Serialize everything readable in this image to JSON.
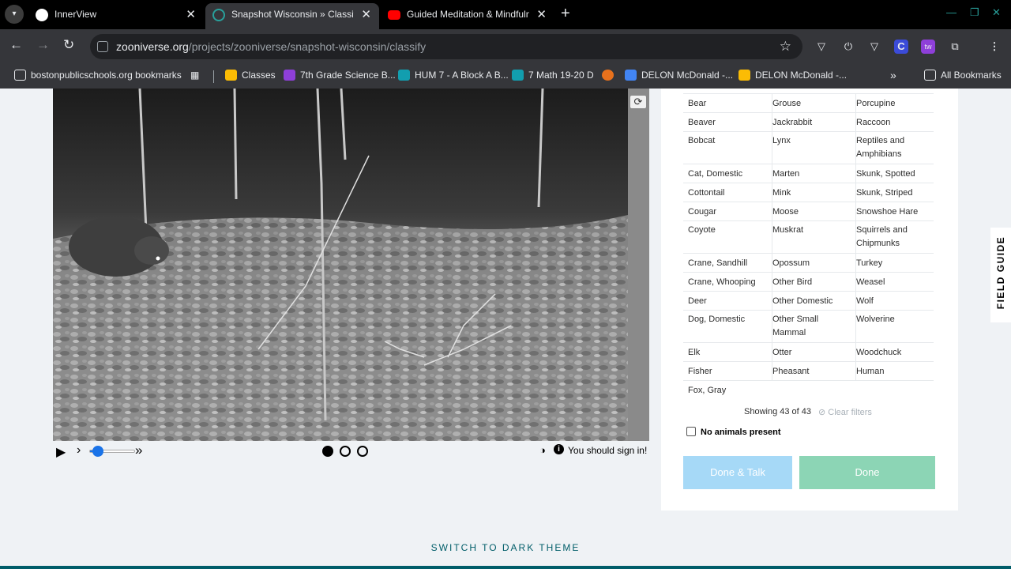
{
  "browser": {
    "tabs": [
      {
        "title": "InnerView",
        "icon": "innerview-favicon",
        "active": false
      },
      {
        "title": "Snapshot Wisconsin » Classify",
        "icon": "zooniverse-favicon",
        "active": true
      },
      {
        "title": "Guided Meditation & Mindfulne",
        "icon": "youtube-favicon",
        "active": false
      }
    ],
    "url_domain": "zooniverse.org",
    "url_path": "/projects/zooniverse/snapshot-wisconsin/classify",
    "bookmarks": [
      {
        "label": "bostonpublicschools.org bookmarks",
        "icon": "folder-icon"
      },
      {
        "label": "Classes",
        "icon": "classroom-icon"
      },
      {
        "label": "7th Grade Science B...",
        "icon": "classroom-icon"
      },
      {
        "label": "HUM 7 - A Block A B...",
        "icon": "classroom-icon"
      },
      {
        "label": "7 Math 19-20 D",
        "icon": "classroom-icon"
      },
      {
        "label": "DELON McDonald -...",
        "icon": "docs-icon"
      },
      {
        "label": "DELON McDonald -...",
        "icon": "slides-icon"
      }
    ],
    "all_bookmarks": "All Bookmarks"
  },
  "viewer": {
    "signin_text": "You should sign in!",
    "frames": 3,
    "current_frame": 1,
    "playback_progress": 0.15
  },
  "panel": {
    "species": [
      [
        "Bear",
        "Grouse",
        "Porcupine"
      ],
      [
        "Beaver",
        "Jackrabbit",
        "Raccoon"
      ],
      [
        "Bobcat",
        "Lynx",
        "Reptiles and Amphibians"
      ],
      [
        "Cat, Domestic",
        "Marten",
        "Skunk, Spotted"
      ],
      [
        "Cottontail",
        "Mink",
        "Skunk, Striped"
      ],
      [
        "Cougar",
        "Moose",
        "Snowshoe Hare"
      ],
      [
        "Coyote",
        "Muskrat",
        "Squirrels and Chipmunks"
      ],
      [
        "Crane, Sandhill",
        "Opossum",
        "Turkey"
      ],
      [
        "Crane, Whooping",
        "Other Bird",
        "Weasel"
      ],
      [
        "Deer",
        "Other Domestic",
        "Wolf"
      ],
      [
        "Dog, Domestic",
        "Other Small Mammal",
        "Wolverine"
      ],
      [
        "Elk",
        "Otter",
        "Woodchuck"
      ],
      [
        "Fisher",
        "Pheasant",
        "Human"
      ],
      [
        "Fox, Gray",
        "",
        ""
      ]
    ],
    "showing": "Showing 43 of 43",
    "clear_filters": "Clear filters",
    "no_animals": "No animals present",
    "done_talk": "Done & Talk",
    "done": "Done"
  },
  "field_guide": "FIELD GUIDE",
  "dark_theme": "SWITCH TO DARK THEME"
}
